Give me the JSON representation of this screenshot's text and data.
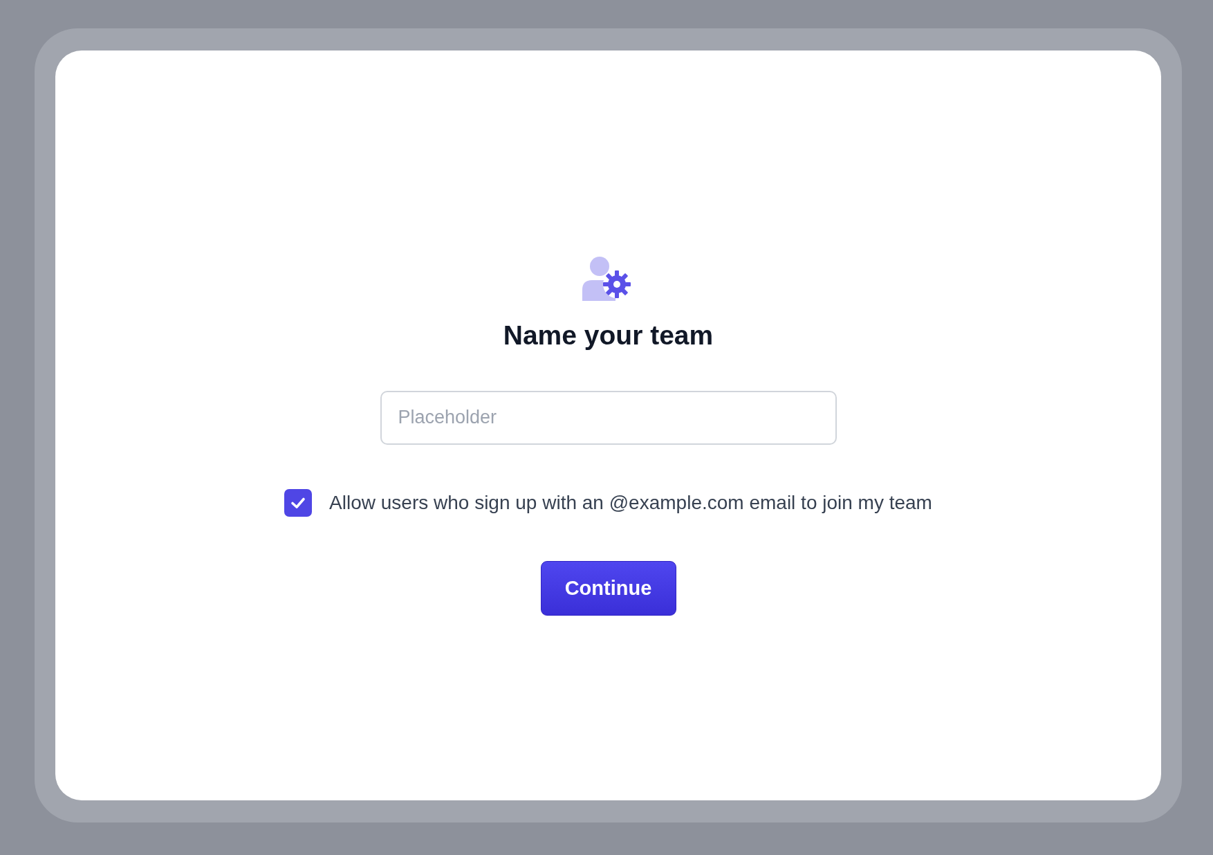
{
  "title": "Name your team",
  "team_name": {
    "placeholder": "Placeholder"
  },
  "allow_domain": {
    "checked": true,
    "label": "Allow users who sign up with an @example.com email to join my team"
  },
  "continue_button": "Continue"
}
